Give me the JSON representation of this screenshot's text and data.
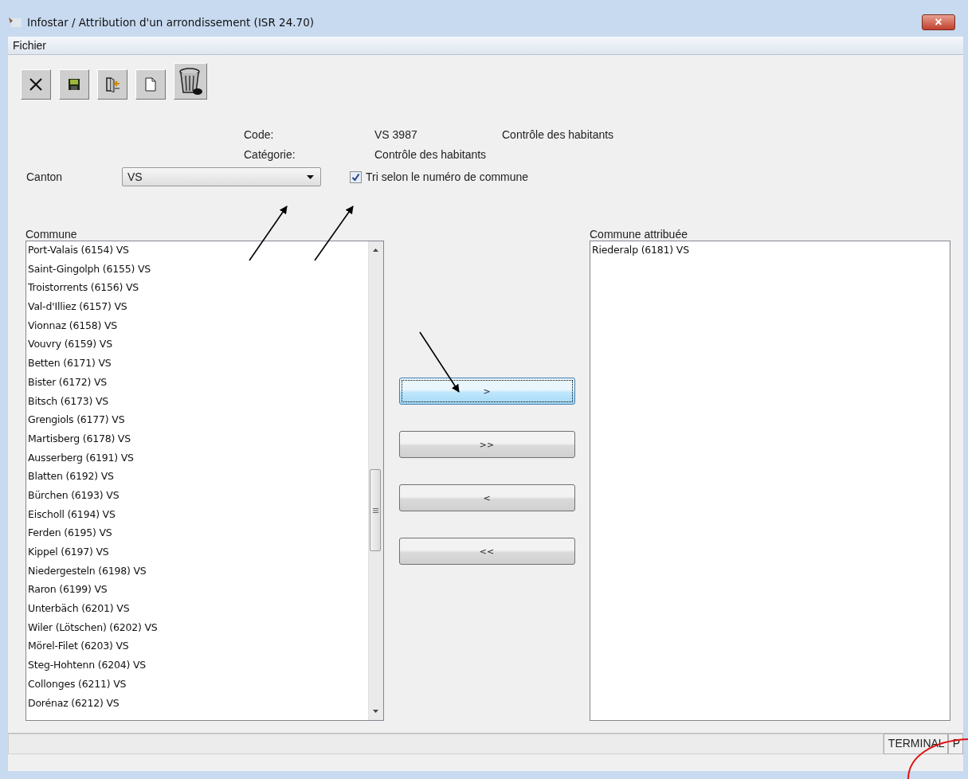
{
  "window": {
    "title": "Infostar / Attribution d'un arrondissement (ISR 24.70)",
    "close": "×"
  },
  "menu": [
    "Fichier"
  ],
  "header": {
    "code_label": "Code:",
    "code_value": "VS 3987",
    "code_description": "Contrôle des habitants",
    "category_label": "Catégorie:",
    "category_value": "Contrôle des habitants"
  },
  "canton": {
    "label": "Canton",
    "value": "VS"
  },
  "sort_option": {
    "label": "Tri selon le numéro de commune",
    "checked": true
  },
  "commune_list": {
    "label": "Commune",
    "items": [
      "Port-Valais (6154) VS",
      "Saint-Gingolph (6155) VS",
      "Troistorrents (6156) VS",
      "Val-d'Illiez (6157) VS",
      "Vionnaz (6158) VS",
      "Vouvry (6159) VS",
      "Betten (6171) VS",
      "Bister (6172) VS",
      "Bitsch (6173) VS",
      "Grengiols (6177) VS",
      "Martisberg (6178) VS",
      "Ausserberg (6191) VS",
      "Blatten (6192) VS",
      "Bürchen (6193) VS",
      "Eischoll (6194) VS",
      "Ferden (6195) VS",
      "Kippel (6197) VS",
      "Niedergesteln (6198) VS",
      "Raron (6199) VS",
      "Unterbäch (6201) VS",
      "Wiler (Lötschen) (6202) VS",
      "Mörel-Filet (6203) VS",
      "Steg-Hohtenn (6204) VS",
      "Collonges (6211) VS",
      "Dorénaz (6212) VS"
    ]
  },
  "transfer_buttons": [
    {
      "label": ">",
      "focused": true
    },
    {
      "label": ">>",
      "focused": false
    },
    {
      "label": "<",
      "focused": false
    },
    {
      "label": "<<",
      "focused": false
    }
  ],
  "assigned_list": {
    "label": "Commune attribuée",
    "items": [
      "Riederalp (6181) VS"
    ]
  },
  "status_bar": [
    "TERMINAL",
    "P"
  ]
}
